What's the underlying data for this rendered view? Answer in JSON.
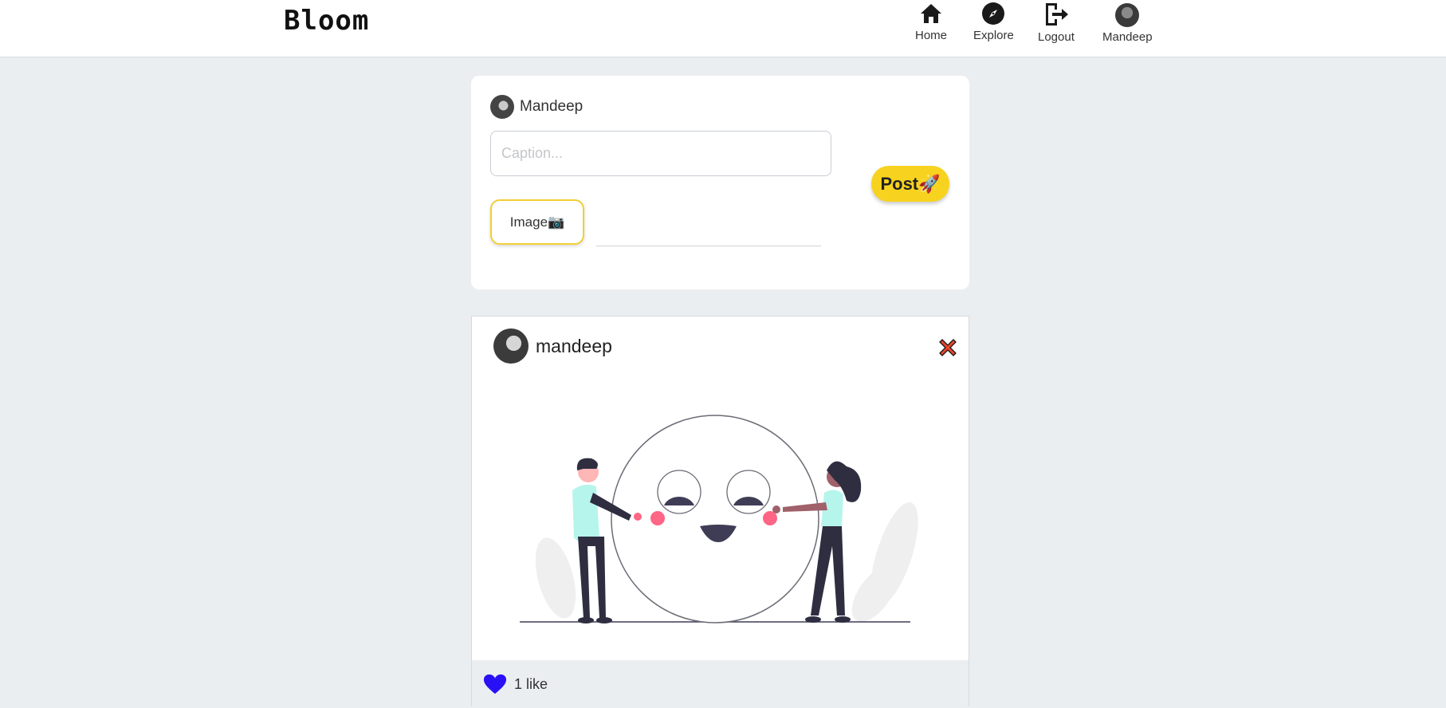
{
  "app": {
    "logo": "Bloom"
  },
  "nav": {
    "home": {
      "label": "Home",
      "icon": "home-icon"
    },
    "explore": {
      "label": "Explore",
      "icon": "compass-icon"
    },
    "logout": {
      "label": "Logout",
      "icon": "logout-icon"
    },
    "profile": {
      "label": "Mandeep",
      "icon": "avatar"
    }
  },
  "create_post": {
    "username": "Mandeep",
    "caption_placeholder": "Caption...",
    "caption_value": "",
    "image_button_label": "Image📷",
    "post_button_label": "Post🚀"
  },
  "posts": [
    {
      "author": "mandeep",
      "like_count_text": "1 like",
      "liked": true,
      "like_color": "#2a11f5",
      "delete_icon_color": "#e8462c"
    }
  ],
  "colors": {
    "accent_yellow": "#f7d31f",
    "background": "#ebeef1"
  }
}
